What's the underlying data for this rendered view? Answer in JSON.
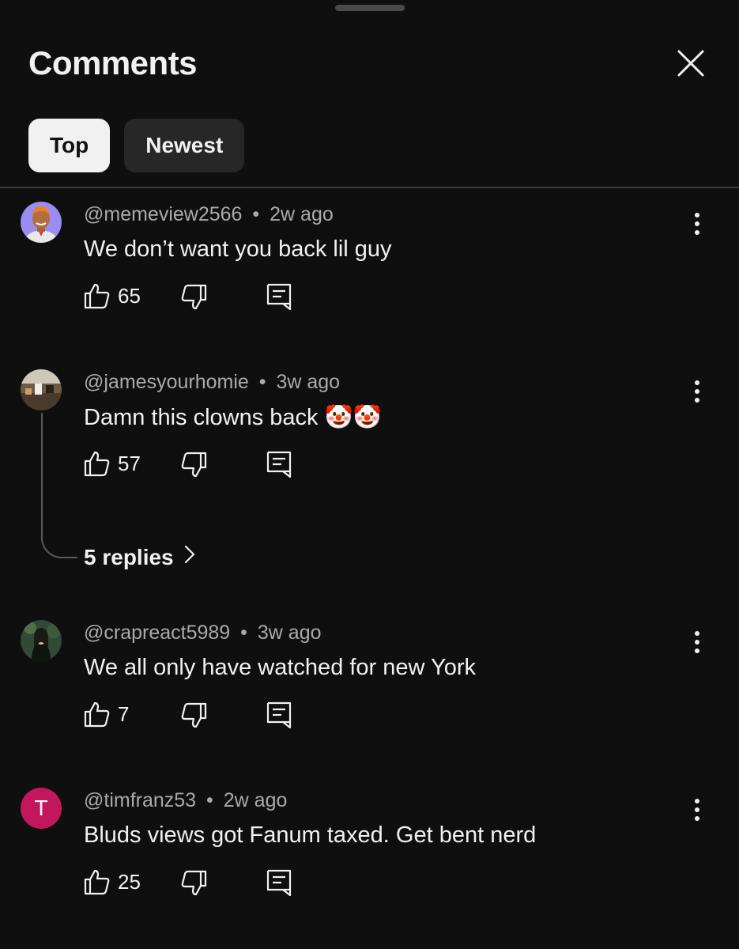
{
  "header": {
    "title": "Comments"
  },
  "tabs": [
    {
      "label": "Top",
      "active": true
    },
    {
      "label": "Newest",
      "active": false
    }
  ],
  "comments": [
    {
      "author": "@memeview2566",
      "time": "2w ago",
      "text": "We don’t want you back lil guy",
      "likes": "65",
      "avatar_icon": "cartoon-avatar-icon",
      "avatar_color": "#9b8df0"
    },
    {
      "author": "@jamesyourhomie",
      "time": "3w ago",
      "text": "Damn this clowns back 🤡🤡",
      "likes": "57",
      "avatar_icon": "photo-avatar-icon",
      "avatar_color": "#6f5a45",
      "replies_label": "5 replies"
    },
    {
      "author": "@crapreact5989",
      "time": "3w ago",
      "text": "We all only have watched for new York",
      "likes": "7",
      "avatar_icon": "photo-avatar-icon",
      "avatar_color": "#2f4a36"
    },
    {
      "author": "@timfranz53",
      "time": "2w ago",
      "text": "Bluds views got Fanum taxed. Get bent nerd",
      "likes": "25",
      "avatar_letter": "T",
      "avatar_color": "#c2185b"
    }
  ],
  "separator": "•"
}
